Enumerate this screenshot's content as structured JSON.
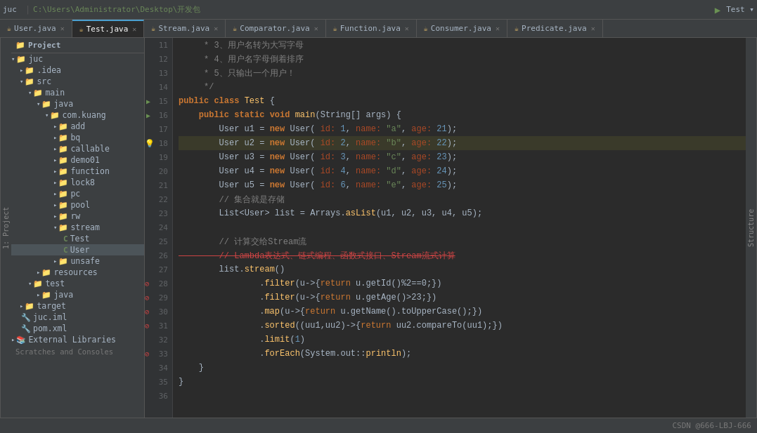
{
  "topbar": {
    "title": "juc",
    "breadcrumb": "C:\\Users\\Administrator\\Desktop\\开发包"
  },
  "tabs": [
    {
      "id": "user-java",
      "label": "User.java",
      "icon_color": "#e8bf6a",
      "active": false
    },
    {
      "id": "test-java",
      "label": "Test.java",
      "icon_color": "#e8bf6a",
      "active": true
    },
    {
      "id": "stream-java",
      "label": "Stream.java",
      "icon_color": "#e8bf6a",
      "active": false
    },
    {
      "id": "comparator-java",
      "label": "Comparator.java",
      "icon_color": "#e8bf6a",
      "active": false
    },
    {
      "id": "function-java",
      "label": "Function.java",
      "icon_color": "#e8bf6a",
      "active": false
    },
    {
      "id": "consumer-java",
      "label": "Consumer.java",
      "icon_color": "#e8bf6a",
      "active": false
    },
    {
      "id": "predicate-java",
      "label": "Predicate.java",
      "icon_color": "#e8bf6a",
      "active": false
    }
  ],
  "sidebar": {
    "header": "Project",
    "project_label": "juc",
    "breadcrumb_path": "C:\\Users\\Administrator\\Desktop\\开发包",
    "tree": [
      {
        "indent": 0,
        "arrow": "▾",
        "icon": "📁",
        "label": "juc",
        "type": "folder"
      },
      {
        "indent": 1,
        "arrow": "▸",
        "icon": "📁",
        "label": ".idea",
        "type": "folder"
      },
      {
        "indent": 1,
        "arrow": "▾",
        "icon": "📁",
        "label": "src",
        "type": "folder"
      },
      {
        "indent": 2,
        "arrow": "▾",
        "icon": "📁",
        "label": "main",
        "type": "folder"
      },
      {
        "indent": 3,
        "arrow": "▾",
        "icon": "📁",
        "label": "java",
        "type": "folder"
      },
      {
        "indent": 4,
        "arrow": "▾",
        "icon": "📁",
        "label": "com.kuang",
        "type": "folder"
      },
      {
        "indent": 5,
        "arrow": "▸",
        "icon": "📁",
        "label": "add",
        "type": "folder"
      },
      {
        "indent": 5,
        "arrow": "▸",
        "icon": "📁",
        "label": "bq",
        "type": "folder"
      },
      {
        "indent": 5,
        "arrow": "▸",
        "icon": "📁",
        "label": "callable",
        "type": "folder"
      },
      {
        "indent": 5,
        "arrow": "▸",
        "icon": "📁",
        "label": "demo01",
        "type": "folder"
      },
      {
        "indent": 5,
        "arrow": "▸",
        "icon": "📁",
        "label": "function",
        "type": "folder"
      },
      {
        "indent": 5,
        "arrow": "▸",
        "icon": "📁",
        "label": "lock8",
        "type": "folder"
      },
      {
        "indent": 5,
        "arrow": "▸",
        "icon": "📁",
        "label": "pc",
        "type": "folder"
      },
      {
        "indent": 5,
        "arrow": "▸",
        "icon": "📁",
        "label": "pool",
        "type": "folder"
      },
      {
        "indent": 5,
        "arrow": "▸",
        "icon": "📁",
        "label": "rw",
        "type": "folder"
      },
      {
        "indent": 5,
        "arrow": "▾",
        "icon": "📁",
        "label": "stream",
        "type": "folder"
      },
      {
        "indent": 6,
        "arrow": " ",
        "icon": "C",
        "label": "Test",
        "type": "class-green"
      },
      {
        "indent": 6,
        "arrow": " ",
        "icon": "C",
        "label": "User",
        "type": "class-green",
        "selected": true
      },
      {
        "indent": 5,
        "arrow": "▸",
        "icon": "📁",
        "label": "unsafe",
        "type": "folder"
      },
      {
        "indent": 3,
        "arrow": "▸",
        "icon": "📁",
        "label": "resources",
        "type": "folder"
      },
      {
        "indent": 2,
        "arrow": "▾",
        "icon": "📁",
        "label": "test",
        "type": "folder"
      },
      {
        "indent": 3,
        "arrow": "▸",
        "icon": "📁",
        "label": "java",
        "type": "folder"
      },
      {
        "indent": 1,
        "arrow": "▸",
        "icon": "📁",
        "label": "target",
        "type": "folder"
      },
      {
        "indent": 1,
        "arrow": " ",
        "icon": "🔧",
        "label": "juc.iml",
        "type": "xml"
      },
      {
        "indent": 1,
        "arrow": " ",
        "icon": "🔧",
        "label": "pom.xml",
        "type": "xml"
      },
      {
        "indent": 0,
        "arrow": "▸",
        "icon": "📚",
        "label": "External Libraries",
        "type": "folder"
      }
    ],
    "scratches_label": "Scratches and Consoles"
  },
  "code": {
    "lines": [
      {
        "num": 11,
        "text": "     * 3、用户名转为大写字母",
        "highlight": false,
        "run": false,
        "warn": false,
        "error": false
      },
      {
        "num": 12,
        "text": "     * 4、用户名字母倒着排序",
        "highlight": false,
        "run": false,
        "warn": false,
        "error": false
      },
      {
        "num": 13,
        "text": "     * 5、只输出一个用户！",
        "highlight": false,
        "run": false,
        "warn": false,
        "error": false
      },
      {
        "num": 14,
        "text": "     */",
        "highlight": false,
        "run": false,
        "warn": false,
        "error": false
      },
      {
        "num": 15,
        "text": "public class Test {",
        "highlight": false,
        "run": true,
        "warn": false,
        "error": false
      },
      {
        "num": 16,
        "text": "    public static void main(String[] args) {",
        "highlight": false,
        "run": true,
        "warn": false,
        "error": false
      },
      {
        "num": 17,
        "text": "        User u1 = new User( id: 1, name: \"a\", age: 21);",
        "highlight": false,
        "run": false,
        "warn": false,
        "error": false
      },
      {
        "num": 18,
        "text": "        User u2 = new User( id: 2, name: \"b\", age: 22);",
        "highlight": true,
        "run": false,
        "warn": true,
        "error": false
      },
      {
        "num": 19,
        "text": "        User u3 = new User( id: 3, name: \"c\", age: 23);",
        "highlight": false,
        "run": false,
        "warn": false,
        "error": false
      },
      {
        "num": 20,
        "text": "        User u4 = new User( id: 4, name: \"d\", age: 24);",
        "highlight": false,
        "run": false,
        "warn": false,
        "error": false
      },
      {
        "num": 21,
        "text": "        User u5 = new User( id: 6, name: \"e\", age: 25);",
        "highlight": false,
        "run": false,
        "warn": false,
        "error": false
      },
      {
        "num": 22,
        "text": "        // 集合就是存储",
        "highlight": false,
        "run": false,
        "warn": false,
        "error": false
      },
      {
        "num": 23,
        "text": "        List<User> list = Arrays.asList(u1, u2, u3, u4, u5);",
        "highlight": false,
        "run": false,
        "warn": false,
        "error": false
      },
      {
        "num": 24,
        "text": "",
        "highlight": false,
        "run": false,
        "warn": false,
        "error": false
      },
      {
        "num": 25,
        "text": "        // 计算交给Stream流",
        "highlight": false,
        "run": false,
        "warn": false,
        "error": false
      },
      {
        "num": 26,
        "text": "        // Lambda表达式、链式编程、函数式接口、Stream流式计算",
        "highlight": false,
        "run": false,
        "warn": false,
        "error": false,
        "red": true
      },
      {
        "num": 27,
        "text": "        list.stream()",
        "highlight": false,
        "run": false,
        "warn": false,
        "error": false
      },
      {
        "num": 28,
        "text": "                .filter(u->{return u.getId()%2==0;})",
        "highlight": false,
        "run": false,
        "warn": false,
        "error": true
      },
      {
        "num": 29,
        "text": "                .filter(u->{return u.getAge()>23;})",
        "highlight": false,
        "run": false,
        "warn": false,
        "error": true
      },
      {
        "num": 30,
        "text": "                .map(u->{return u.getName().toUpperCase();})",
        "highlight": false,
        "run": false,
        "warn": false,
        "error": true
      },
      {
        "num": 31,
        "text": "                .sorted((uu1,uu2)->{return uu2.compareTo(uu1);})",
        "highlight": false,
        "run": false,
        "warn": false,
        "error": true
      },
      {
        "num": 32,
        "text": "                .limit(1)",
        "highlight": false,
        "run": false,
        "warn": false,
        "error": false
      },
      {
        "num": 33,
        "text": "                .forEach(System.out::println);",
        "highlight": false,
        "run": false,
        "warn": false,
        "error": true
      },
      {
        "num": 34,
        "text": "    }",
        "highlight": false,
        "run": false,
        "warn": false,
        "error": false
      },
      {
        "num": 35,
        "text": "}",
        "highlight": false,
        "run": false,
        "warn": false,
        "error": false
      },
      {
        "num": 36,
        "text": "",
        "highlight": false,
        "run": false,
        "warn": false,
        "error": false
      }
    ]
  },
  "bottom": {
    "watermark": "CSDN @666-LBJ-666"
  },
  "vertical_label": "1: Project",
  "structure_label": "Structure"
}
